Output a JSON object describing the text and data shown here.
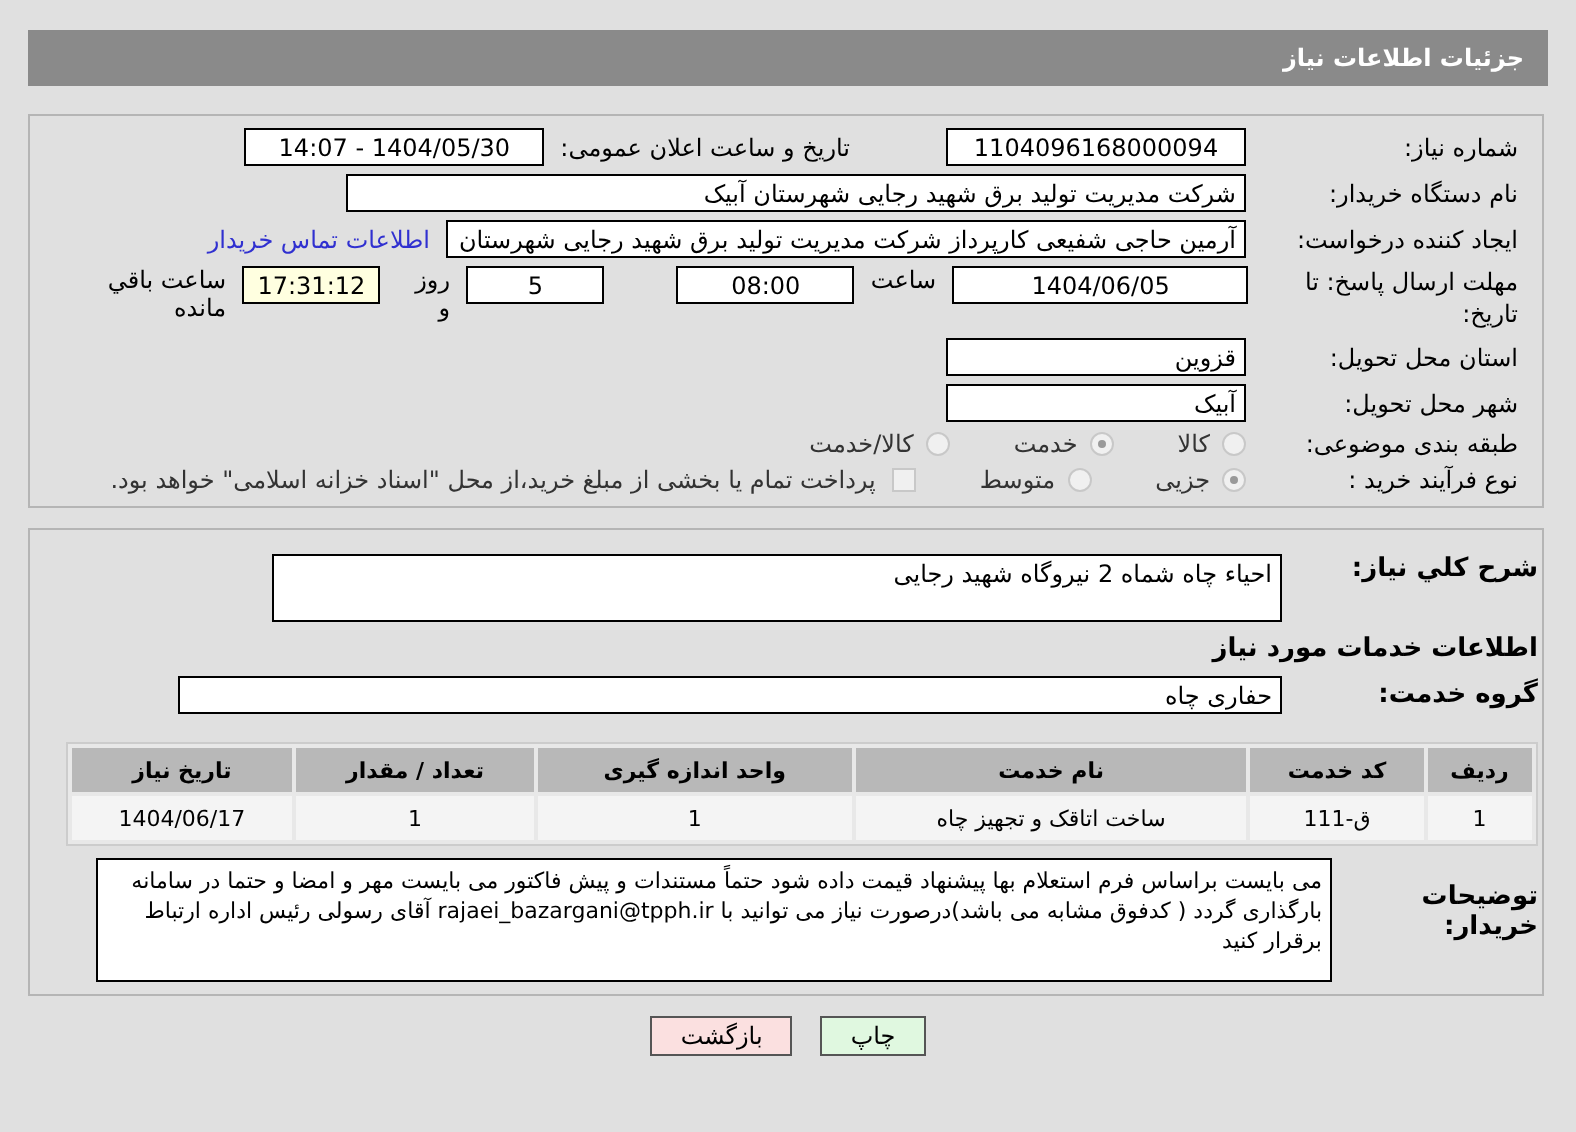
{
  "header": {
    "title": "جزئیات اطلاعات نیاز"
  },
  "fields": {
    "need_number": {
      "label": "شماره نیاز:",
      "value": "1104096168000094"
    },
    "announce": {
      "label": "تاریخ و ساعت اعلان عمومی:",
      "value": "1404/05/30 - 14:07"
    },
    "buyer": {
      "label": "نام دستگاه خریدار:",
      "value": "شرکت مدیریت تولید برق شهید رجایی شهرستان آبیک"
    },
    "creator": {
      "label": "ایجاد کننده درخواست:",
      "value": "آرمین حاجی شفیعی کارپرداز شرکت مدیریت تولید برق شهید رجایی شهرستان",
      "link": "اطلاعات تماس خریدار"
    },
    "deadline": {
      "label": "مهلت ارسال پاسخ: تا تاریخ:",
      "date": "1404/06/05",
      "time_label": "ساعت",
      "time": "08:00",
      "days": "5",
      "days_label": "روز و",
      "remaining": "17:31:12",
      "remaining_label": "ساعت باقي مانده"
    },
    "province": {
      "label": "استان محل تحویل:",
      "value": "قزوین"
    },
    "city": {
      "label": "شهر محل تحویل:",
      "value": "آبیک"
    }
  },
  "category": {
    "label": "طبقه بندی موضوعی:",
    "options": [
      {
        "label": "کالا",
        "selected": false
      },
      {
        "label": "خدمت",
        "selected": true
      },
      {
        "label": "کالا/خدمت",
        "selected": false
      }
    ]
  },
  "purchase_type": {
    "label": "نوع فرآیند خرید :",
    "options": [
      {
        "label": "جزیی",
        "selected": true
      },
      {
        "label": "متوسط",
        "selected": false
      }
    ],
    "payment": {
      "checked": false,
      "text": "پرداخت تمام یا بخشی از مبلغ خرید،از محل \"اسناد خزانه اسلامی\" خواهد بود."
    }
  },
  "summary": {
    "label": "شرح کلي نياز:",
    "value": "احیاء چاه شماه 2 نیروگاه شهید رجایی"
  },
  "services_title": "اطلاعات خدمات مورد نیاز",
  "service_group": {
    "label": "گروه خدمت:",
    "value": "حفاری چاه"
  },
  "table": {
    "columns": [
      "ردیف",
      "کد خدمت",
      "نام خدمت",
      "واحد اندازه گیری",
      "تعداد / مقدار",
      "تاریخ نیاز"
    ],
    "rows": [
      [
        "1",
        "ق-111",
        "ساخت اتاقک و تجهیز چاه",
        "1",
        "1",
        "1404/06/17"
      ]
    ]
  },
  "notes": {
    "label": "توضیحات خریدار:",
    "value": "می بایست براساس فرم استعلام بها پیشنهاد قیمت داده شود حتماً مستندات و پیش فاکتور می بایست مهر و امضا و حتما در سامانه بارگذاری گردد ( کدفوق مشابه می باشد)درصورت نیاز می توانید با rajaei_bazargani@tpph.ir آقای رسولی  رئیس اداره ارتباط برقرار کنید"
  },
  "buttons": [
    {
      "label": "چاپ",
      "kind": "print"
    },
    {
      "label": "بازگشت",
      "kind": "back"
    }
  ]
}
